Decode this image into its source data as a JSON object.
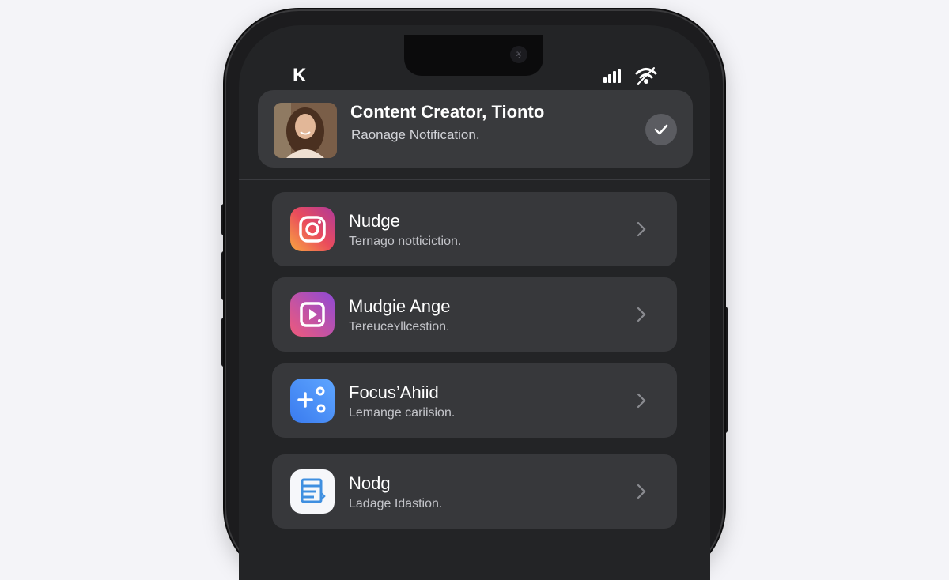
{
  "status_bar": {
    "left_glyph": "K",
    "camera_glyph": "ϗ"
  },
  "header": {
    "title": "Content Creator, Tionto",
    "subtitle": "Raonage Notification."
  },
  "items": [
    {
      "title": "Nudge",
      "subtitle": "Ternago notticiction.",
      "icon": "instagram-icon"
    },
    {
      "title": "Mudgie Ange",
      "subtitle": "Tereuceʏllcestion.",
      "icon": "video-app-icon"
    },
    {
      "title": "Focus’Ahiid",
      "subtitle": "Lemange cariision.",
      "icon": "focus-app-icon"
    },
    {
      "title": "Nodg",
      "subtitle": "Ladage Idastion.",
      "icon": "notes-app-icon"
    }
  ],
  "colors": {
    "screen_bg": "#232426",
    "card_bg": "#37383b",
    "header_bg": "#393a3d"
  }
}
